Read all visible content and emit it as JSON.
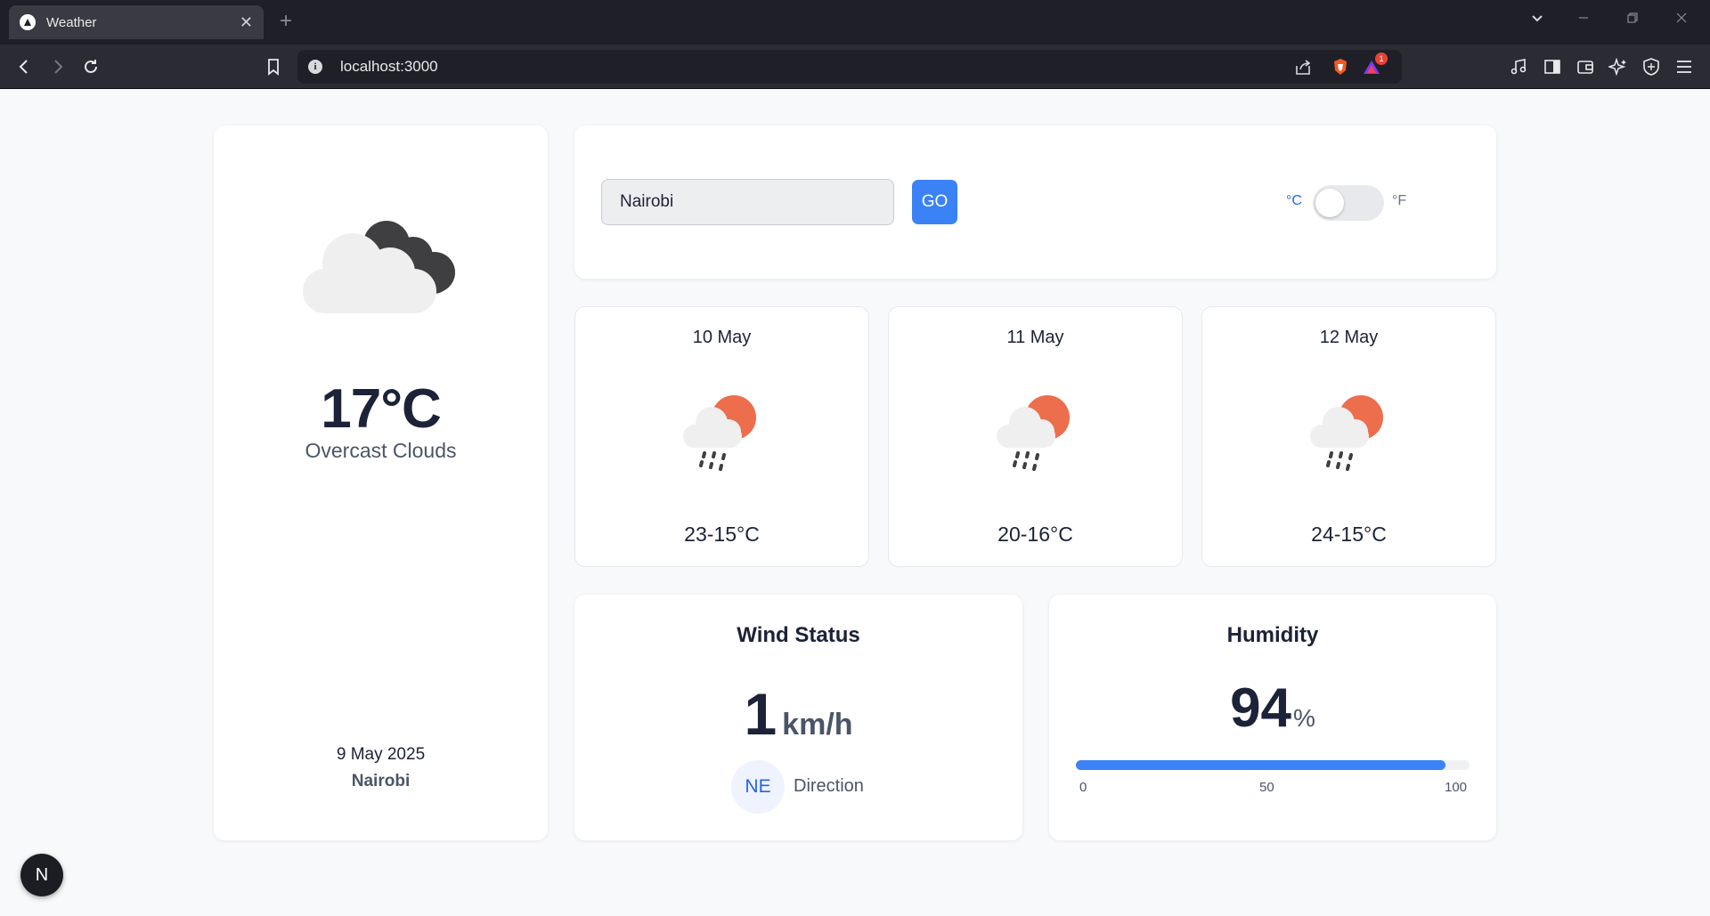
{
  "browser": {
    "tab_title": "Weather",
    "tab_close": "✕",
    "new_tab": "+",
    "url": "localhost:3000",
    "notification_count": "1"
  },
  "current": {
    "icon": "overcast-clouds-icon",
    "temperature": "17°C",
    "description": "Overcast Clouds",
    "date": "9 May 2025",
    "city": "Nairobi"
  },
  "search": {
    "value": "Nairobi",
    "button_label": "GO",
    "unit_celsius": "°C",
    "unit_fahrenheit": "°F",
    "unit_selected": "celsius"
  },
  "forecast": [
    {
      "date": "10 May",
      "icon": "sun-cloud-rain-icon",
      "range": "23-15°C"
    },
    {
      "date": "11 May",
      "icon": "sun-cloud-rain-icon",
      "range": "20-16°C"
    },
    {
      "date": "12 May",
      "icon": "sun-cloud-rain-icon",
      "range": "24-15°C"
    }
  ],
  "wind": {
    "title": "Wind Status",
    "speed": "1",
    "unit": "km/h",
    "direction": "NE",
    "direction_label": "Direction"
  },
  "humidity": {
    "title": "Humidity",
    "value": "94",
    "unit": "%",
    "percent": 94,
    "ticks": [
      "0",
      "50",
      "100"
    ]
  },
  "dev_badge": "N",
  "colors": {
    "accent": "#3b82f6",
    "sun": "#ec6e4c",
    "cloud_dark": "#3f3f42",
    "cloud_light": "#efefef"
  }
}
